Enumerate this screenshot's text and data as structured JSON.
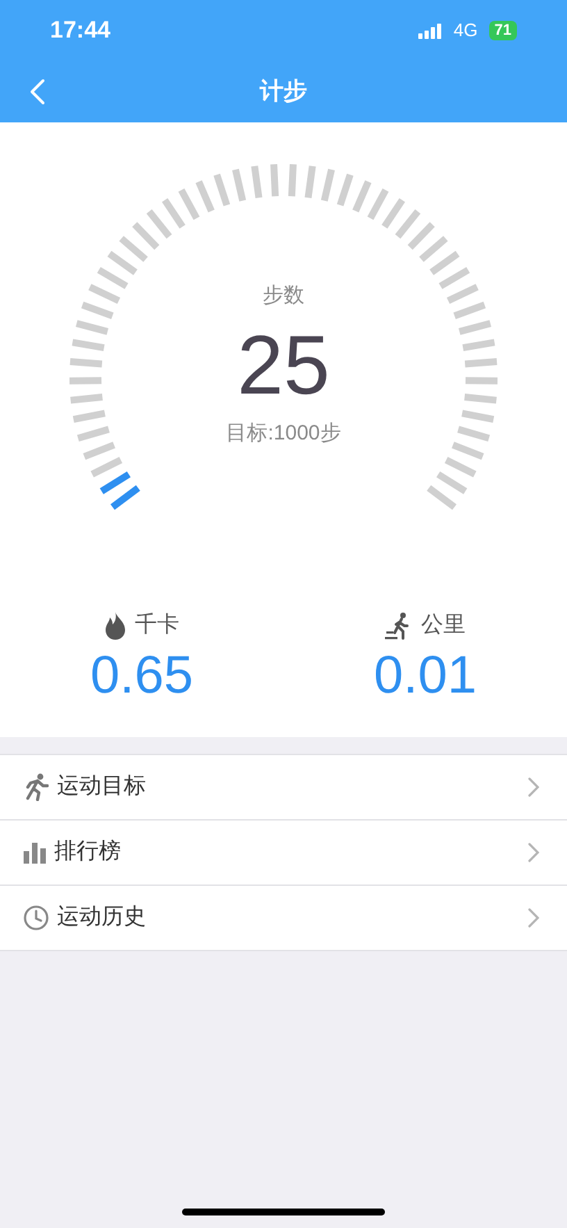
{
  "status_bar": {
    "time": "17:44",
    "network": "4G",
    "battery": "71"
  },
  "nav": {
    "title": "计步"
  },
  "gauge": {
    "label": "步数",
    "value": "25",
    "goal": "目标:1000步"
  },
  "stats": [
    {
      "kind": "calories",
      "label": "千卡",
      "value": "0.65"
    },
    {
      "kind": "distance",
      "label": "公里",
      "value": "0.01"
    }
  ],
  "menu": [
    {
      "kind": "goal",
      "label": "运动目标"
    },
    {
      "kind": "ranking",
      "label": "排行榜"
    },
    {
      "kind": "history",
      "label": "运动历史"
    }
  ]
}
